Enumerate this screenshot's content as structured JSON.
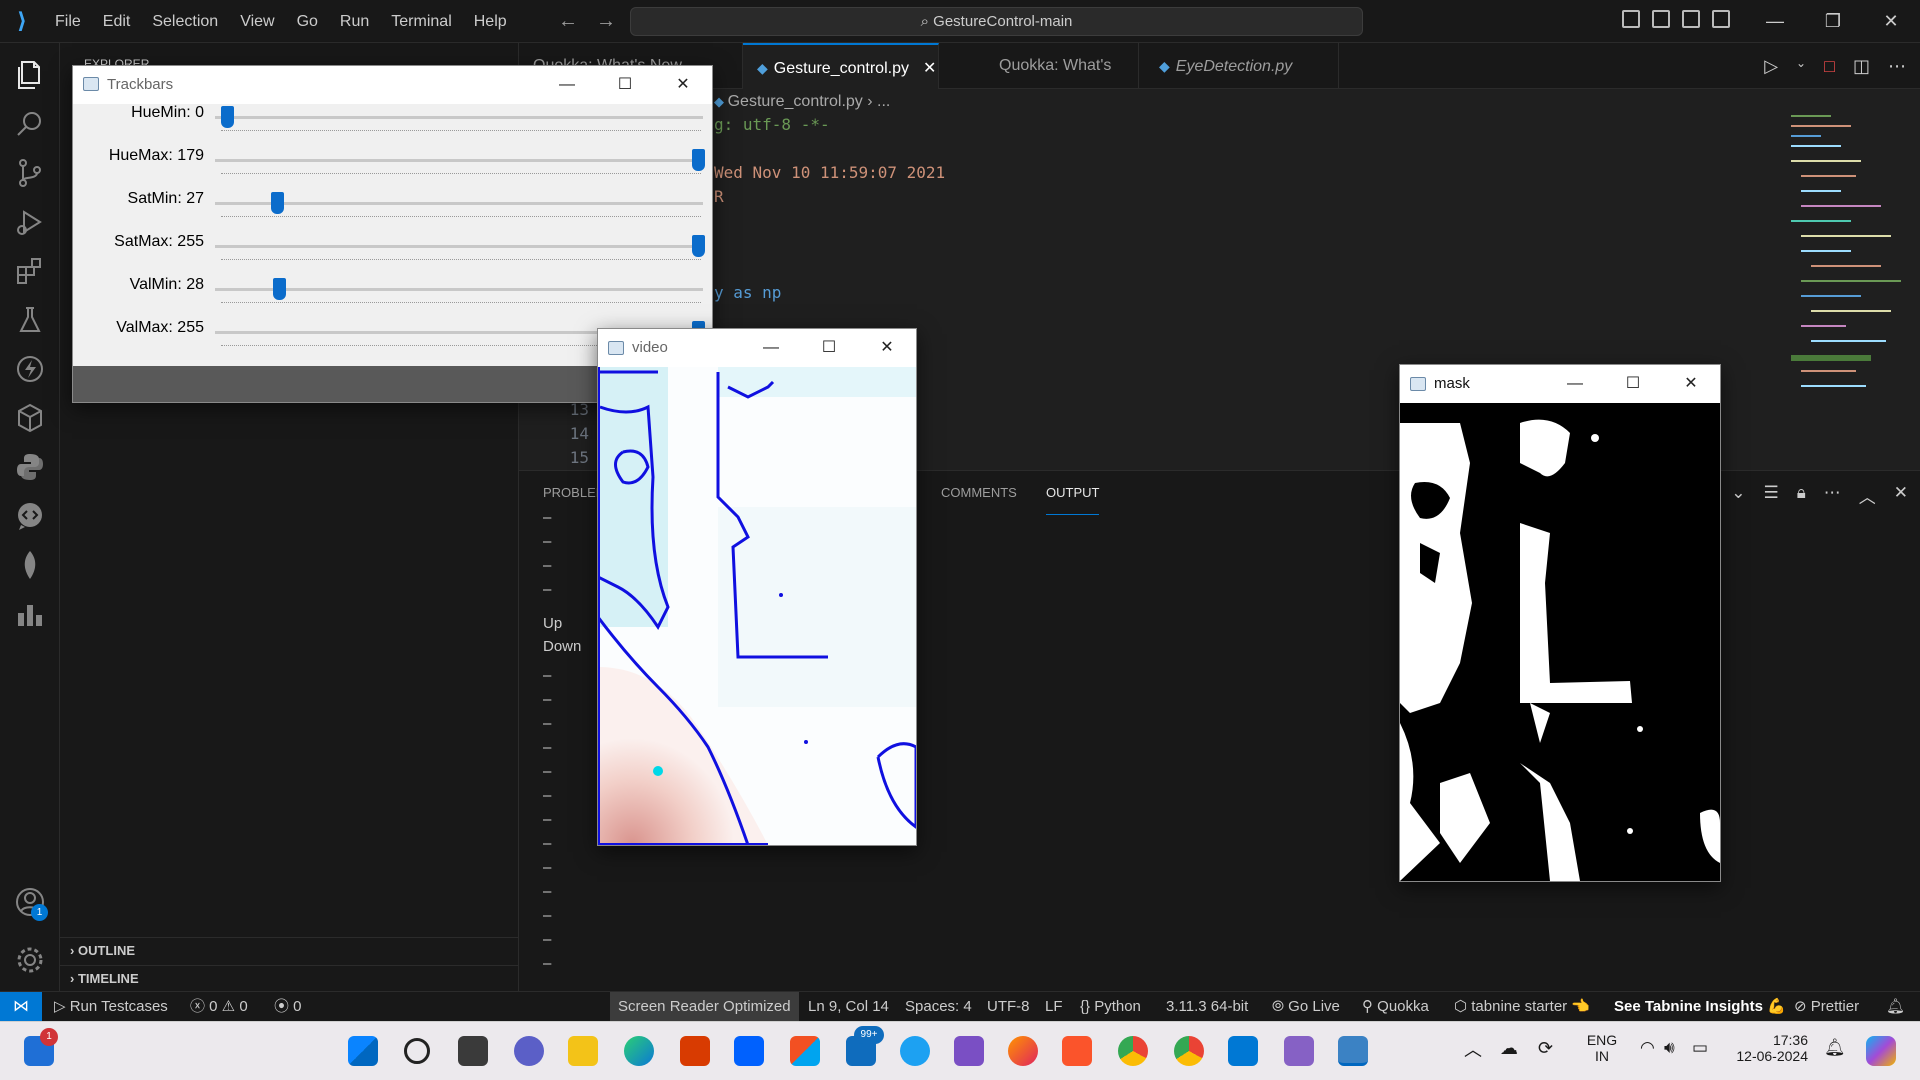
{
  "titlebar": {
    "menu": [
      "File",
      "Edit",
      "Selection",
      "View",
      "Go",
      "Run",
      "Terminal",
      "Help"
    ],
    "search": "GestureControl-main"
  },
  "sidebar": {
    "header": "EXPLORER",
    "outline": "OUTLINE",
    "timeline": "TIMELINE"
  },
  "tabs": [
    {
      "label": "Quokka: What's New",
      "active": false
    },
    {
      "label": "Gesture_control.py",
      "active": true
    },
    {
      "label": "Quokka: What's New",
      "active": false
    },
    {
      "label": "EyeDetection.py",
      "active": false
    }
  ],
  "breadcrumb": {
    "file": "Gesture_control.py",
    "rest": "..."
  },
  "editor": {
    "code_lines": [
      {
        "text": "g: utf-8 -*-",
        "color": "#6a9955"
      },
      {
        "text": "",
        "color": "#ce9178"
      },
      {
        "text": "Wed Nov 10 11:59:07 2021",
        "color": "#ce9178"
      },
      {
        "text": "R",
        "color": "#ce9178"
      },
      {
        "text": "y as np",
        "color": "#569cd6"
      }
    ],
    "line_numbers": [
      "13",
      "14",
      "15"
    ]
  },
  "panel": {
    "tabs": [
      "PROBLEMS",
      "COMMENTS",
      "OUTPUT"
    ],
    "active_tab": "OUTPUT",
    "output_lines": [
      "–",
      "–",
      "–",
      "–",
      "Up",
      "Down",
      "–",
      "–",
      "–",
      "–",
      "–",
      "–",
      "–",
      "–",
      "–",
      "–",
      "–",
      "–",
      "–"
    ]
  },
  "statusbar": {
    "run_testcases": "Run Testcases",
    "errors": "0",
    "warnings": "0",
    "ports": "0",
    "screen_reader": "Screen Reader Optimized",
    "position": "Ln 9, Col 14",
    "spaces": "Spaces: 4",
    "encoding": "UTF-8",
    "eol": "LF",
    "language": "Python",
    "interpreter": "3.11.3 64-bit",
    "golive": "Go Live",
    "quokka": "Quokka",
    "tabnine": "tabnine starter",
    "tabnine_insights": "See Tabnine Insights",
    "prettier": "Prettier"
  },
  "trackbars_window": {
    "title": "Trackbars",
    "rows": [
      {
        "label": "HueMin: 0",
        "value": 0,
        "max": 179
      },
      {
        "label": "HueMax: 179",
        "value": 179,
        "max": 179
      },
      {
        "label": "SatMin: 27",
        "value": 27,
        "max": 255
      },
      {
        "label": "SatMax: 255",
        "value": 255,
        "max": 255
      },
      {
        "label": "ValMin: 28",
        "value": 28,
        "max": 255
      },
      {
        "label": "ValMax: 255",
        "value": 255,
        "max": 255
      }
    ]
  },
  "video_window": {
    "title": "video"
  },
  "mask_window": {
    "title": "mask"
  },
  "taskbar": {
    "outlook_badge": "1",
    "mail_badge": "99+",
    "lang": "ENG",
    "region": "IN",
    "time": "17:36",
    "date": "12-06-2024"
  },
  "accounts_badge": "1",
  "colors": {
    "accent": "#0078d4",
    "bg": "#1e1e1e",
    "trackbar_thumb": "#0b6ccb",
    "contour": "#1010e0"
  }
}
